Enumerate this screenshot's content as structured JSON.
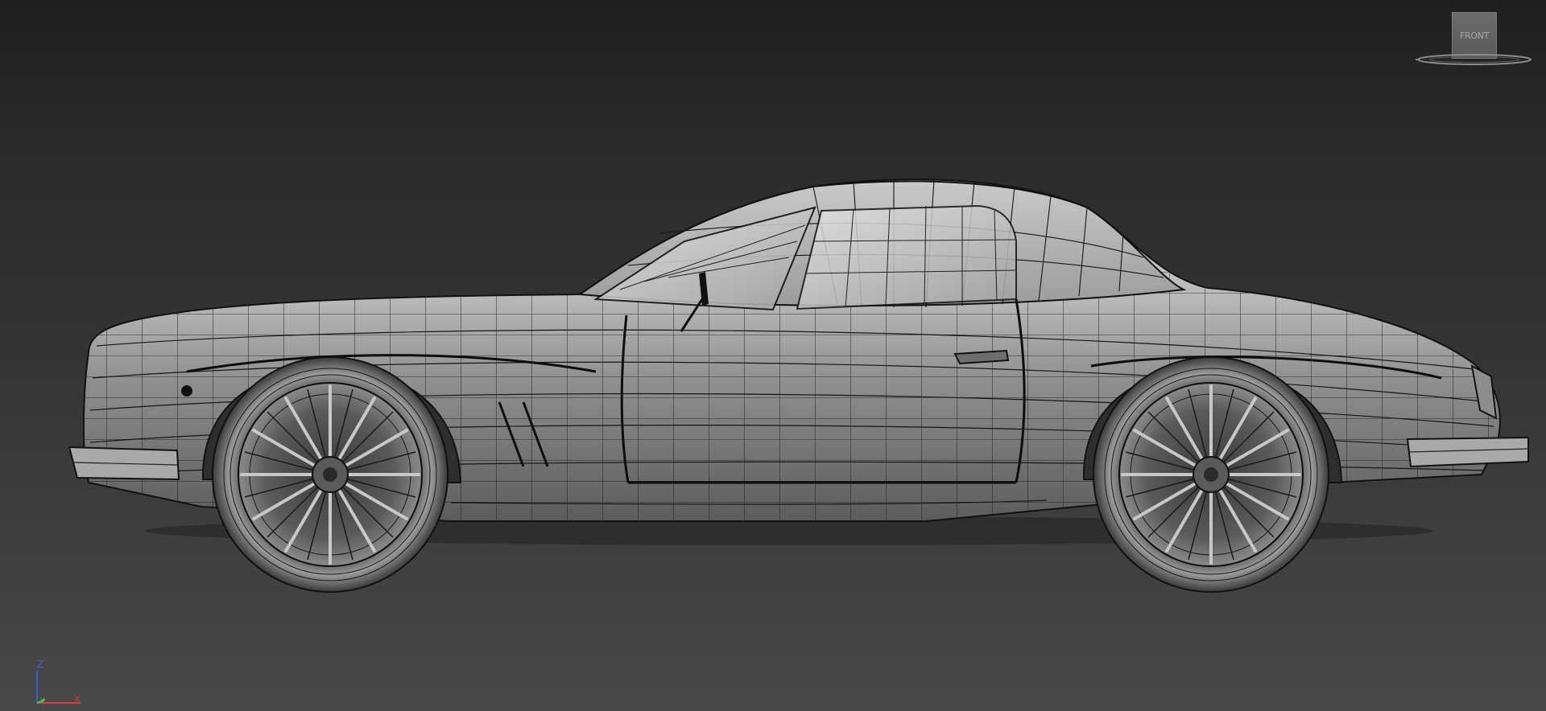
{
  "viewport": {
    "background_top": "#1f1f1f",
    "background_bottom": "#484848"
  },
  "viewcube": {
    "face_label": "FRONT"
  },
  "axis_tripod": {
    "z_label": "Z",
    "x_label": "X",
    "y_label": "Y",
    "z_color": "#3b5fd9",
    "x_color": "#d93b3b",
    "y_color": "#3bd94a"
  },
  "model": {
    "shading": "wireframe-on-shaded",
    "view": "side"
  }
}
